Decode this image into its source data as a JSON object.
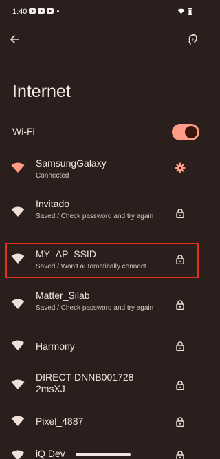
{
  "status_bar": {
    "time": "1:40"
  },
  "header": {
    "title": "Internet"
  },
  "wifi": {
    "label": "Wi-Fi",
    "enabled": true
  },
  "networks": [
    {
      "name": "SamsungGalaxy",
      "status": "Connected",
      "action_icon": "gear-icon"
    },
    {
      "name": "Invitado",
      "status": "Saved / Check password and try again",
      "action_icon": "lock-icon"
    },
    {
      "name": "MY_AP_SSID",
      "status": "Saved / Won't automatically connect",
      "action_icon": "lock-icon"
    },
    {
      "name": "Matter_Silab",
      "status": "Saved / Check password and try again",
      "action_icon": "lock-icon"
    },
    {
      "name": "Harmony",
      "status": "",
      "action_icon": "lock-icon"
    },
    {
      "name": "DIRECT-DNNB0017282msXJ",
      "status": "",
      "action_icon": "lock-icon"
    },
    {
      "name": "Pixel_4887",
      "status": "",
      "action_icon": "lock-icon"
    },
    {
      "name": "iQ Dev",
      "status": "",
      "action_icon": "lock-icon"
    }
  ],
  "colors": {
    "background": "#2a1f1d",
    "accent": "#ff9b86",
    "highlight": "#e0301e"
  }
}
